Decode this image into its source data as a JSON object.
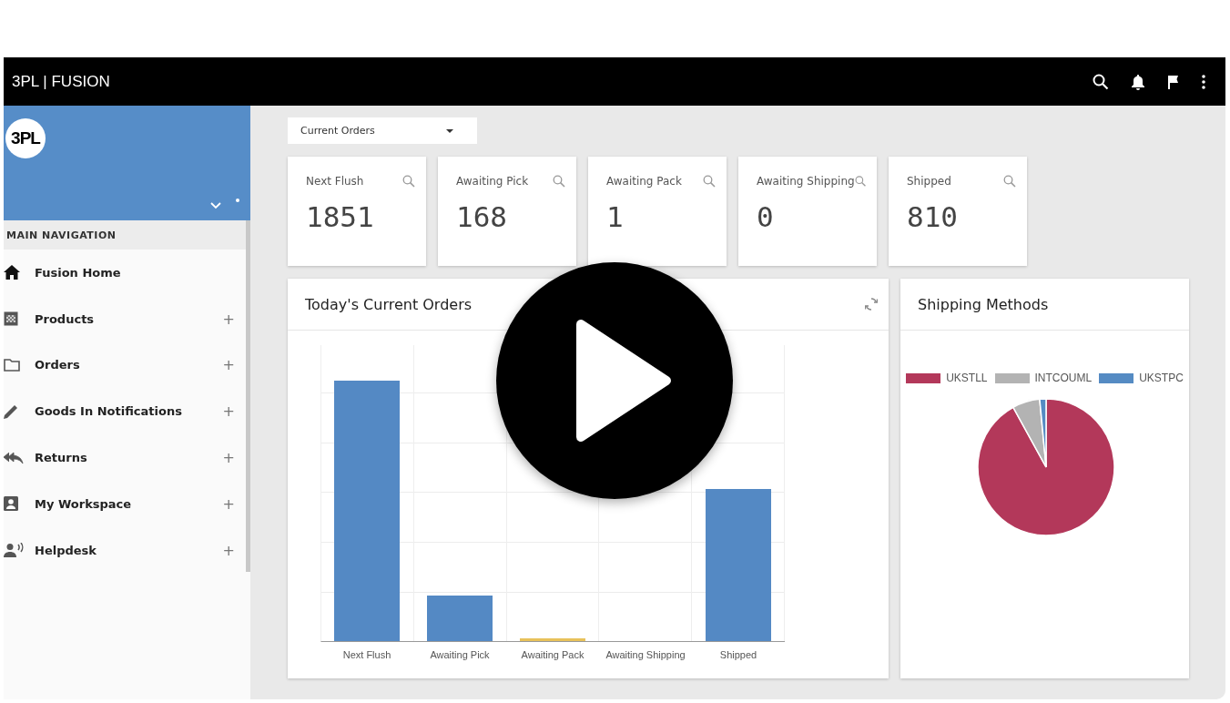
{
  "header": {
    "title": "3PL | FUSION"
  },
  "sidebar": {
    "logo": "3PL",
    "section_title": "MAIN NAVIGATION",
    "items": [
      {
        "label": "Fusion Home"
      },
      {
        "label": "Products",
        "expand_mark": "+"
      },
      {
        "label": "Orders",
        "expand_mark": "+"
      },
      {
        "label": "Goods In Notifications",
        "expand_mark": "+"
      },
      {
        "label": "Returns",
        "expand_mark": "+"
      },
      {
        "label": "My Workspace",
        "expand_mark": "+"
      },
      {
        "label": "Helpdesk",
        "expand_mark": "+"
      }
    ]
  },
  "view_select": {
    "value": "Current Orders"
  },
  "stats": [
    {
      "label": "Next Flush",
      "value": "1851"
    },
    {
      "label": "Awaiting Pick",
      "value": "168"
    },
    {
      "label": "Awaiting Pack",
      "value": "1"
    },
    {
      "label": "Awaiting Shipping",
      "value": "0"
    },
    {
      "label": "Shipped",
      "value": "810"
    }
  ],
  "orders_panel": {
    "title": "Today's Current Orders",
    "categories": [
      "Next Flush",
      "Awaiting Pick",
      "Awaiting Pack",
      "Awaiting Shipping",
      "Shipped"
    ]
  },
  "shipping_panel": {
    "title": "Shipping Methods",
    "legend": [
      {
        "label": "UKSTLL",
        "color": "#b3385a"
      },
      {
        "label": "INTCOUML",
        "color": "#b3b3b3"
      },
      {
        "label": "UKSTPC",
        "color": "#558bc3"
      }
    ]
  }
}
